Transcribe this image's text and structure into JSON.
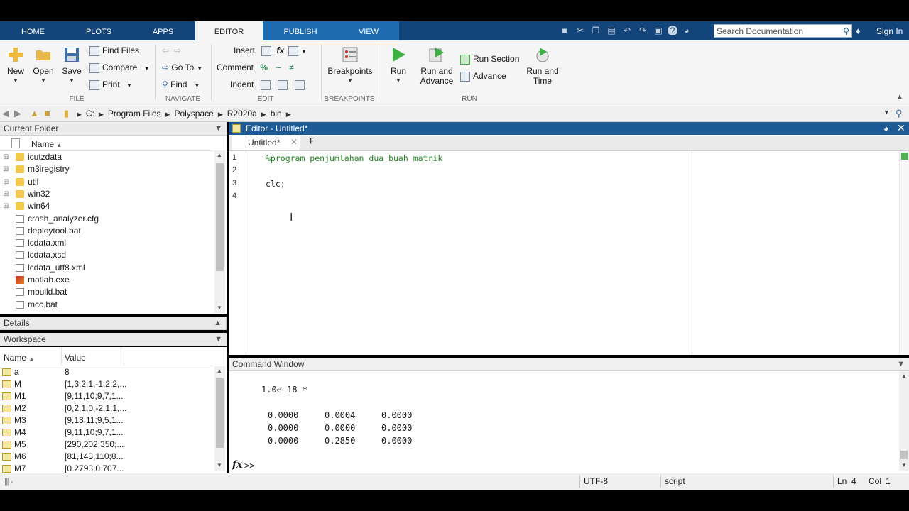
{
  "ribbon_tabs": [
    "HOME",
    "PLOTS",
    "APPS",
    "EDITOR",
    "PUBLISH",
    "VIEW"
  ],
  "search_placeholder": "Search Documentation",
  "sign_in": "Sign In",
  "file_group": {
    "new": "New",
    "open": "Open",
    "save": "Save",
    "find_files": "Find Files",
    "compare": "Compare",
    "print": "Print",
    "label": "FILE"
  },
  "navigate_group": {
    "go_to": "Go To",
    "find": "Find",
    "label": "NAVIGATE"
  },
  "edit_group": {
    "insert": "Insert",
    "comment": "Comment",
    "indent": "Indent",
    "label": "EDIT"
  },
  "breakpoints_group": {
    "breakpoints": "Breakpoints",
    "label": "BREAKPOINTS"
  },
  "run_group": {
    "run": "Run",
    "run_and_advance": [
      "Run and",
      "Advance"
    ],
    "run_section": "Run Section",
    "advance": "Advance",
    "run_and_time": [
      "Run and",
      "Time"
    ],
    "label": "RUN"
  },
  "address_path": [
    "C:",
    "Program Files",
    "Polyspace",
    "R2020a",
    "bin"
  ],
  "current_folder": {
    "title": "Current Folder",
    "column": "Name",
    "folders": [
      "icutzdata",
      "m3iregistry",
      "util",
      "win32",
      "win64"
    ],
    "files": [
      "crash_analyzer.cfg",
      "deploytool.bat",
      "lcdata.xml",
      "lcdata.xsd",
      "lcdata_utf8.xml",
      "matlab.exe",
      "mbuild.bat",
      "mcc.bat"
    ]
  },
  "details_title": "Details",
  "workspace": {
    "title": "Workspace",
    "col_name": "Name",
    "col_value": "Value",
    "rows": [
      {
        "name": "a",
        "value": "8"
      },
      {
        "name": "M",
        "value": "[1,3,2;1,-1,2;2,..."
      },
      {
        "name": "M1",
        "value": "[9,11,10;9,7,1..."
      },
      {
        "name": "M2",
        "value": "[0,2,1;0,-2,1;1,..."
      },
      {
        "name": "M3",
        "value": "[9,13,11;9,5,1..."
      },
      {
        "name": "M4",
        "value": "[9,11,10;9,7,1..."
      },
      {
        "name": "M5",
        "value": "[290,202,350;..."
      },
      {
        "name": "M6",
        "value": "[81,143,110;8..."
      },
      {
        "name": "M7",
        "value": "[0.2793,0.707..."
      }
    ]
  },
  "editor": {
    "title": "Editor - Untitled*",
    "tab": "Untitled*",
    "line_numbers": [
      "1",
      "2",
      "3",
      "4"
    ],
    "lines": [
      "%program penjumlahan dua buah matrik",
      "",
      "clc;",
      ""
    ]
  },
  "command_window": {
    "title": "Command Window",
    "scale": "1.0e-18 *",
    "matrix": [
      [
        "0.0000",
        "0.0004",
        "0.0000"
      ],
      [
        "0.0000",
        "0.0000",
        "0.0000"
      ],
      [
        "0.0000",
        "0.2850",
        "0.0000"
      ]
    ],
    "prompt": ">>"
  },
  "status": {
    "encoding": "UTF-8",
    "type": "script",
    "ln_label": "Ln",
    "ln": "4",
    "col_label": "Col",
    "col": "1"
  },
  "colors": {
    "tab_strip": "#14457a",
    "active_tab_blue": "#1f6bb0",
    "editor_title": "#1c5a96",
    "comment_green": "#228b22"
  }
}
